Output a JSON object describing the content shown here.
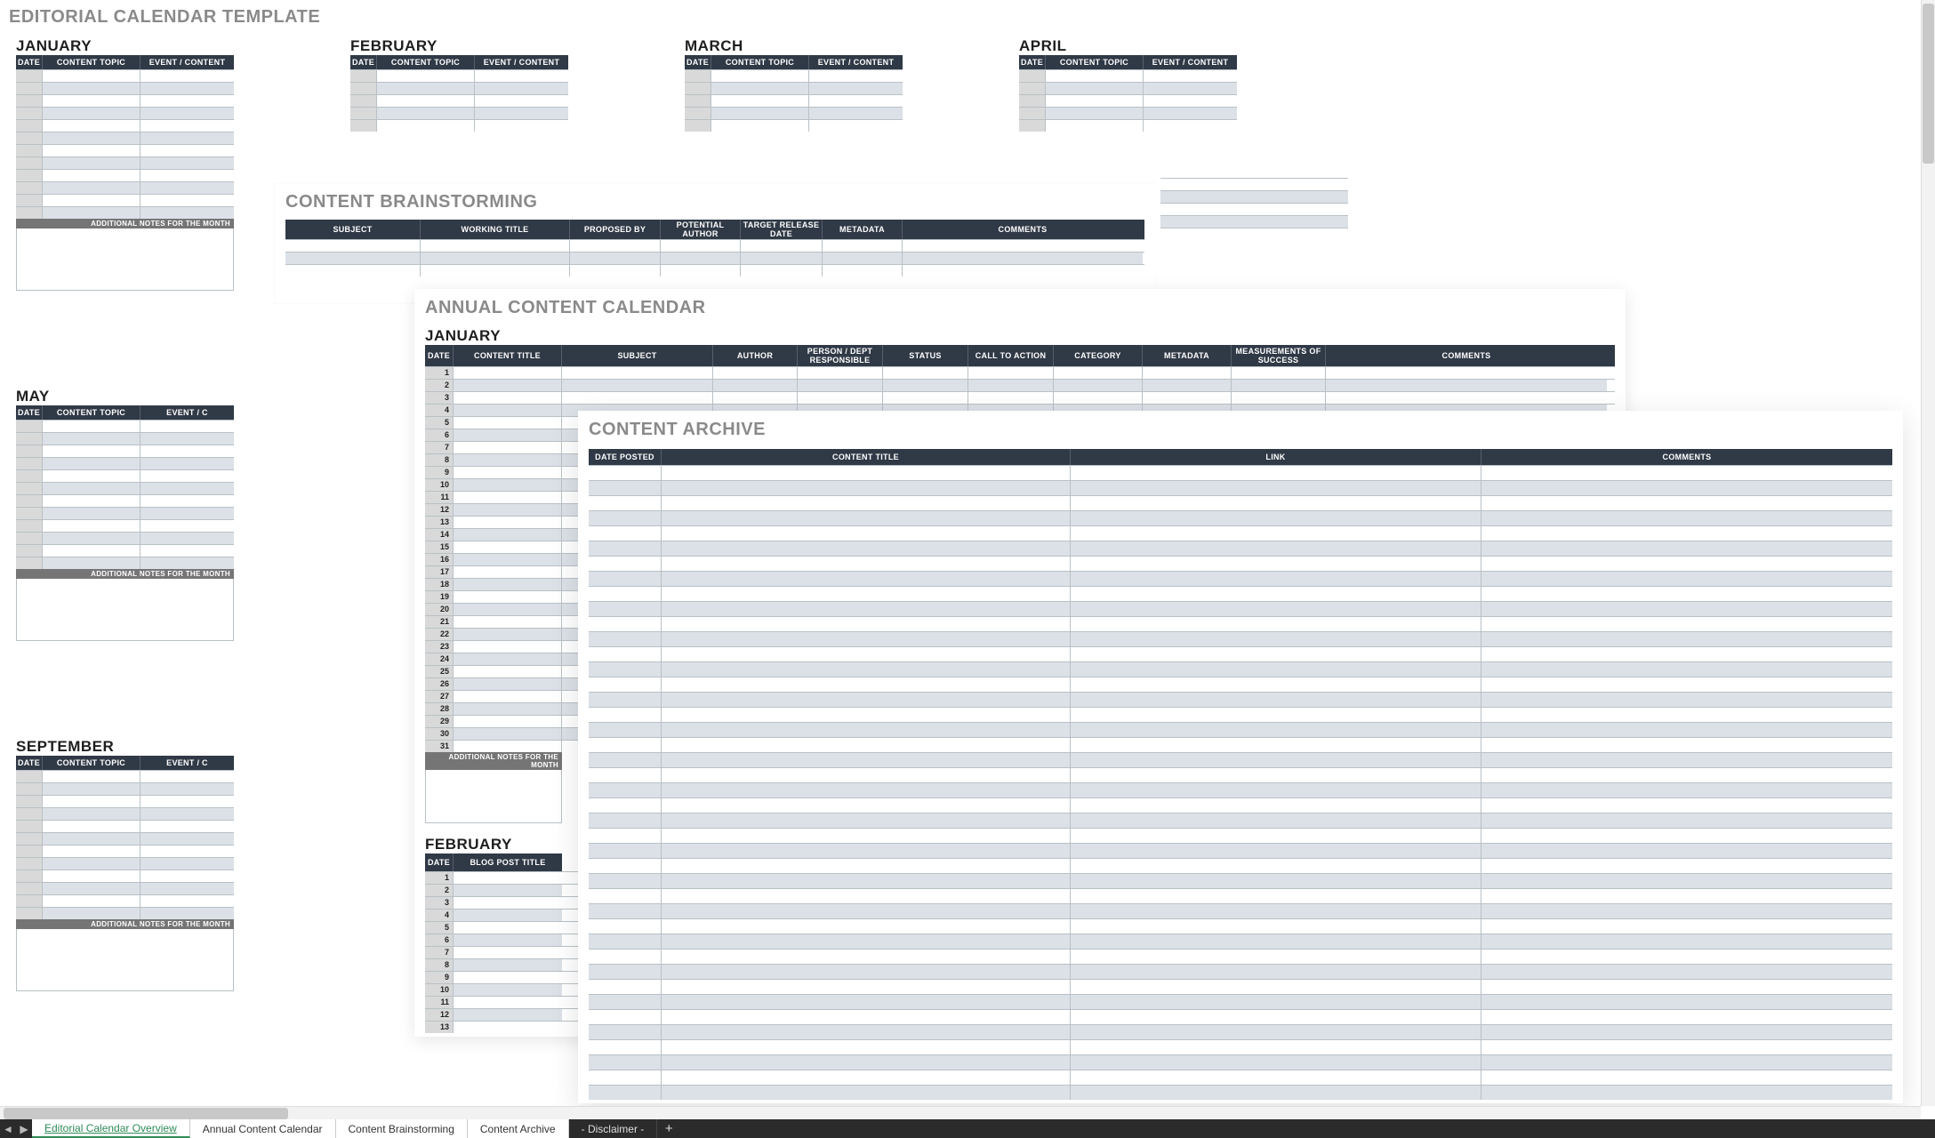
{
  "editorial": {
    "title": "EDITORIAL CALENDAR TEMPLATE",
    "columns": {
      "date": "DATE",
      "topic": "CONTENT TOPIC",
      "event": "EVENT / CONTENT"
    },
    "notes_label": "ADDITIONAL NOTES FOR THE MONTH",
    "months_row1": [
      "JANUARY",
      "FEBRUARY",
      "MARCH",
      "APRIL"
    ],
    "months_row2": [
      "MAY"
    ],
    "months_row3": [
      "SEPTEMBER"
    ]
  },
  "brainstorm": {
    "title": "CONTENT BRAINSTORMING",
    "columns": [
      "SUBJECT",
      "WORKING TITLE",
      "PROPOSED BY",
      "POTENTIAL AUTHOR",
      "TARGET RELEASE DATE",
      "METADATA",
      "COMMENTS"
    ]
  },
  "annual": {
    "title": "ANNUAL CONTENT CALENDAR",
    "jan_label": "JANUARY",
    "jan_columns": [
      "DATE",
      "CONTENT TITLE",
      "SUBJECT",
      "AUTHOR",
      "PERSON / DEPT RESPONSIBLE",
      "STATUS",
      "CALL TO ACTION",
      "CATEGORY",
      "METADATA",
      "MEASUREMENTS OF SUCCESS",
      "COMMENTS"
    ],
    "notes_label": "ADDITIONAL NOTES FOR THE MONTH",
    "feb_label": "FEBRUARY",
    "feb_columns": [
      "DATE",
      "BLOG POST TITLE"
    ]
  },
  "archive": {
    "title": "CONTENT ARCHIVE",
    "columns": [
      "DATE POSTED",
      "CONTENT TITLE",
      "LINK",
      "COMMENTS"
    ]
  },
  "tabs": {
    "prev": "◄",
    "next": "▶",
    "tab1": "Editorial Calendar Overview",
    "tab2": "Annual Content Calendar",
    "tab3": "Content Brainstorming",
    "tab4": "Content Archive",
    "tab5": "- Disclaimer -",
    "plus": "+"
  }
}
